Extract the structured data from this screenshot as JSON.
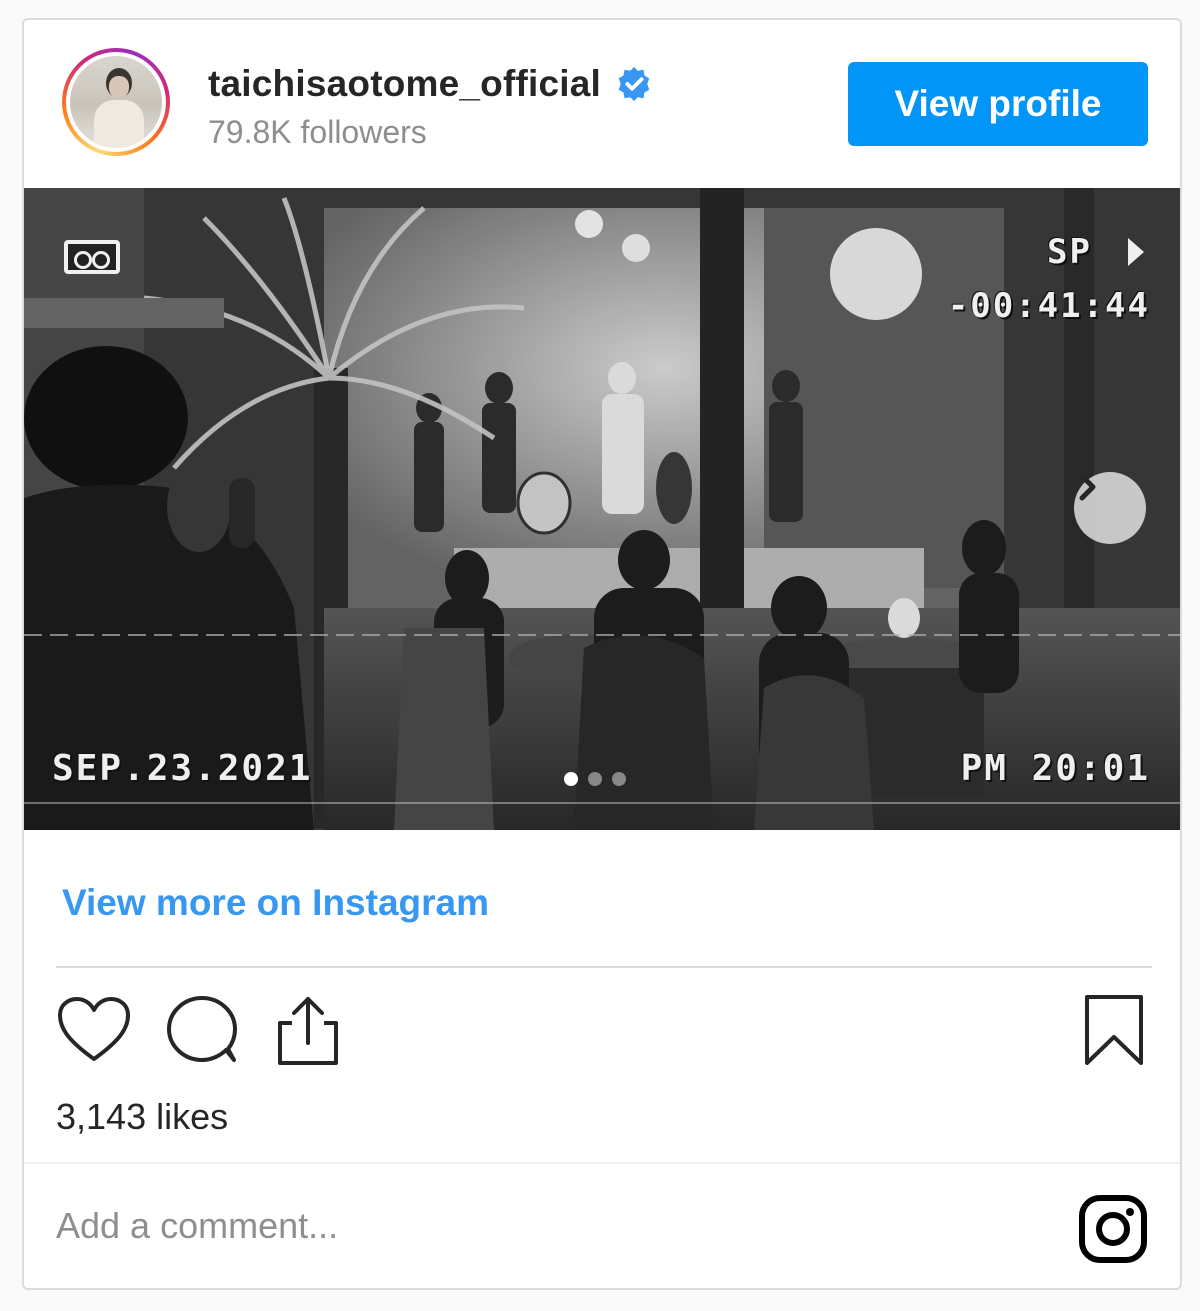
{
  "header": {
    "username": "taichisaotome_official",
    "followers": "79.8K followers",
    "verified": true,
    "view_profile_label": "View profile",
    "avatar_icon": "profile-photo"
  },
  "media": {
    "osd_date": "SEP.23.2021",
    "osd_time": "PM 20:01",
    "osd_mode": "SP",
    "osd_counter": "-00:41:44",
    "slide_count": 3,
    "active_slide": 1,
    "next_icon": "chevron-right-icon"
  },
  "links": {
    "view_more": "View more on Instagram"
  },
  "actions": {
    "icons": [
      "heart-icon",
      "comment-icon",
      "share-icon",
      "bookmark-icon"
    ]
  },
  "likes": "3,143 likes",
  "comment": {
    "placeholder": "Add a comment..."
  },
  "colors": {
    "accent": "#0095f6",
    "link": "#3897f0",
    "muted": "#8e8e8e",
    "text": "#262626",
    "verified_badge": "#3897f0"
  }
}
